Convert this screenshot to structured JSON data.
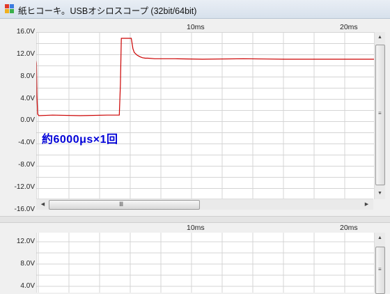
{
  "window": {
    "title": "紙ヒコーキ。USBオシロスコープ (32bit/64bit)",
    "icon": "app-icon"
  },
  "scope1": {
    "time_labels": [
      "10ms",
      "20ms"
    ],
    "y_labels": [
      "16.0V",
      "12.0V",
      "8.0V",
      "4.0V",
      "0.0V",
      "-4.0V",
      "-8.0V",
      "-12.0V",
      "-16.0V"
    ],
    "annotation": "約6000μs×1回",
    "trace_color": "#cc0000",
    "grid_color": "#d4d4d4",
    "hscroll_grip": "Ⅲ",
    "vscroll_grip": "≡"
  },
  "scope2": {
    "time_labels": [
      "10ms",
      "20ms"
    ],
    "y_labels": [
      "12.0V",
      "8.0V",
      "4.0V"
    ],
    "vscroll_grip": "≡"
  },
  "chart_data": [
    {
      "type": "line",
      "title": "",
      "xlabel": "",
      "ylabel": "",
      "ylim": [
        -16,
        16
      ],
      "xlim": [
        -0.2,
        24.6
      ],
      "x_tick_labels": [
        "10ms",
        "20ms"
      ],
      "y_tick_labels": [
        "16.0V",
        "12.0V",
        "8.0V",
        "4.0V",
        "0.0V",
        "-4.0V",
        "-8.0V",
        "-12.0V",
        "-16.0V"
      ],
      "grid": true,
      "series": [
        {
          "color": "#cc0000",
          "x": [
            -0.2,
            -0.18,
            -0.15,
            -0.1,
            0.0,
            1.0,
            3.0,
            5.0,
            5.9,
            5.98,
            6.05,
            6.2,
            6.7,
            6.78,
            6.8,
            6.9,
            7.0,
            7.2,
            7.4,
            7.6,
            7.8,
            8.0,
            8.5,
            9.0,
            10.0,
            12.0,
            15.0,
            18.0,
            20.0,
            22.0,
            24.6
          ],
          "y": [
            10.5,
            10.0,
            4.0,
            0.3,
            0.0,
            0.1,
            0.0,
            0.1,
            0.1,
            6.0,
            14.8,
            14.8,
            14.8,
            14.8,
            14.5,
            12.8,
            12.1,
            11.6,
            11.3,
            11.1,
            11.0,
            11.0,
            10.9,
            10.9,
            10.9,
            10.8,
            10.9,
            10.8,
            10.8,
            10.8,
            10.8
          ]
        }
      ]
    },
    {
      "type": "line",
      "title": "",
      "xlabel": "",
      "ylabel": "",
      "ylim": [
        4,
        12
      ],
      "x_tick_labels": [
        "10ms",
        "20ms"
      ],
      "y_tick_labels": [
        "12.0V",
        "8.0V",
        "4.0V"
      ],
      "grid": true,
      "series": []
    }
  ]
}
